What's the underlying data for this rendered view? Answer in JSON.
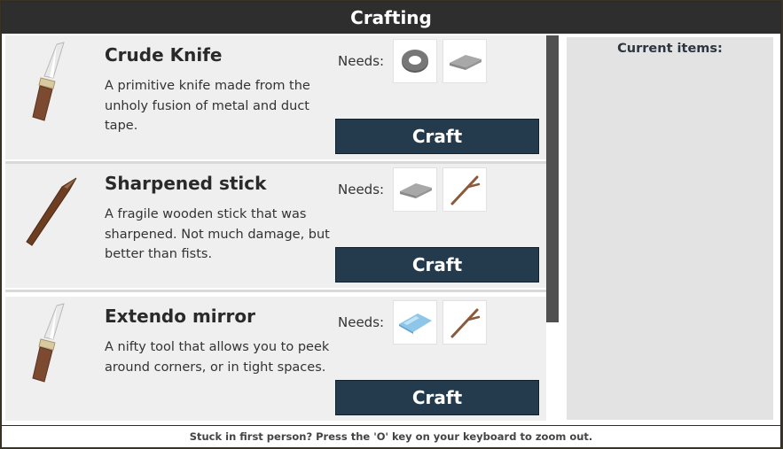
{
  "window": {
    "title": "Crafting"
  },
  "needs_label": "Needs:",
  "craft_label": "Craft",
  "recipes": [
    {
      "name": "Crude Knife",
      "description": "A primitive knife made from the unholy fusion of metal and duct tape.",
      "icon": "knife-icon",
      "ingredients": [
        "duct-tape-icon",
        "metal-plate-icon"
      ]
    },
    {
      "name": "Sharpened stick",
      "description": "A fragile wooden stick that was sharpened. Not much damage, but better than fists.",
      "icon": "sharpened-stick-icon",
      "ingredients": [
        "metal-plate-icon",
        "stick-icon"
      ]
    },
    {
      "name": "Extendo mirror",
      "description": "A nifty tool that allows you to peek around corners, or in tight spaces.",
      "icon": "knife-icon",
      "ingredients": [
        "mirror-glass-icon",
        "stick-icon"
      ]
    }
  ],
  "current_items": {
    "title": "Current items:"
  },
  "footer": {
    "hint": "Stuck in first person? Press the 'O' key on your keyboard to zoom out."
  },
  "colors": {
    "title_bar": "#2e2e2e",
    "craft_button": "#243a4d",
    "row_background": "#efefef",
    "panel_background": "#e3e3e3",
    "scroll_thumb": "#505050"
  }
}
